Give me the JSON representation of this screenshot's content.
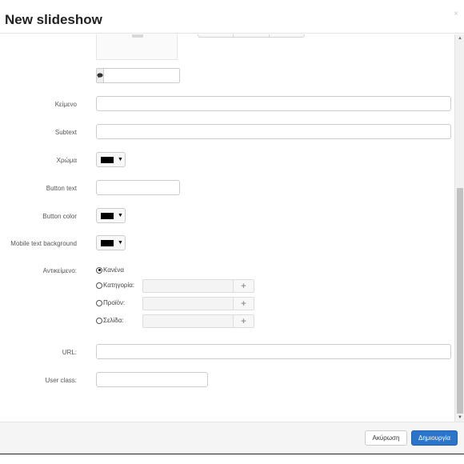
{
  "dialog": {
    "title": "New slideshow",
    "close_glyph": "×"
  },
  "icons": {
    "close": "close-icon",
    "comment": "comment-icon",
    "caret": "caret-down-icon",
    "plus": "plus-icon",
    "image_placeholder": "image-placeholder-icon"
  },
  "form": {
    "caption_input": {
      "value": ""
    },
    "text": {
      "label": "Κείμενο",
      "value": ""
    },
    "subtext": {
      "label": "Subtext",
      "value": ""
    },
    "color": {
      "label": "Χρώμα",
      "value": "#000000"
    },
    "button_text": {
      "label": "Button text",
      "value": ""
    },
    "button_color": {
      "label": "Button color",
      "value": "#000000"
    },
    "mobile_text_background": {
      "label": "Mobile text background",
      "value": "#000000"
    },
    "object": {
      "label": "Αντικείμενο:",
      "options": [
        {
          "label": "Κανένα",
          "checked": true
        },
        {
          "label": "Κατηγορία:",
          "checked": false
        },
        {
          "label": "Προϊόν:",
          "checked": false
        },
        {
          "label": "Σελίδα:",
          "checked": false
        }
      ],
      "plus_glyph": "+"
    },
    "url": {
      "label": "URL:",
      "value": ""
    },
    "user_class": {
      "label": "User class:",
      "value": ""
    }
  },
  "glyphs": {
    "caret": "▼",
    "comment": "●",
    "scroll_up": "▲",
    "scroll_down": "▼"
  },
  "footer": {
    "cancel_label": "Ακύρωση",
    "create_label": "Δημιουργία",
    "primary_color": "#2a74c9"
  }
}
